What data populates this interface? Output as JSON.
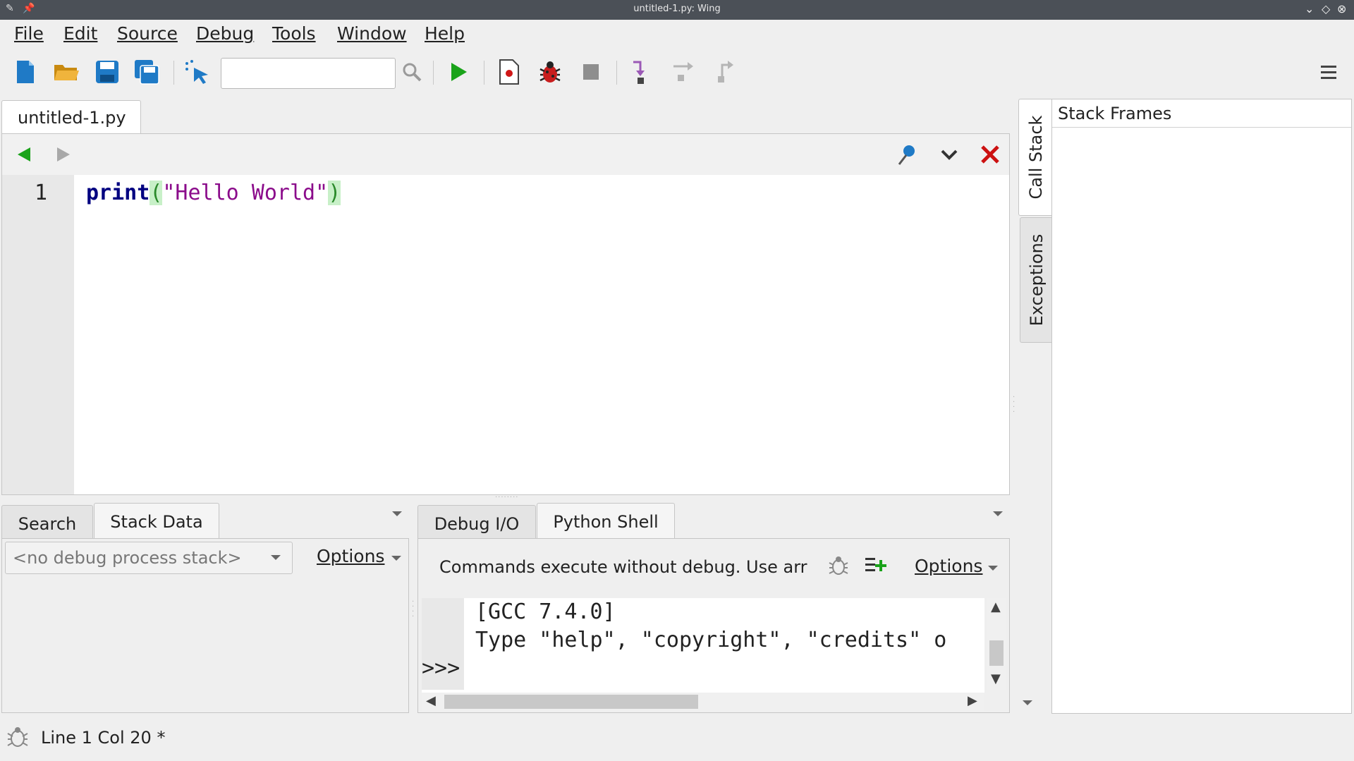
{
  "window": {
    "title": "untitled-1.py: Wing",
    "title_icons": [
      "pencil-icon",
      "pin-icon"
    ],
    "controls": [
      "minimize-icon",
      "restore-icon",
      "close-icon"
    ]
  },
  "menu": [
    {
      "label": "File"
    },
    {
      "label": "Edit"
    },
    {
      "label": "Source"
    },
    {
      "label": "Debug"
    },
    {
      "label": "Tools"
    },
    {
      "label": "Window"
    },
    {
      "label": "Help"
    }
  ],
  "toolbar": {
    "search_value": "",
    "icons": [
      "new-file-icon",
      "open-folder-icon",
      "save-icon",
      "save-all-icon",
      "select-pointer-icon",
      "search-icon",
      "run-icon",
      "breakpoint-icon",
      "debug-bug-icon",
      "stop-icon",
      "step-into-icon",
      "step-over-icon",
      "step-out-icon",
      "hamburger-menu-icon"
    ]
  },
  "editor": {
    "tab_label": "untitled-1.py",
    "line_numbers": [
      "1"
    ],
    "code": {
      "keyword": "print",
      "open_paren": "(",
      "string": "\"Hello World\"",
      "close_paren": ")"
    }
  },
  "left_panel": {
    "tabs": [
      {
        "label": "Search"
      },
      {
        "label": "Stack Data"
      }
    ],
    "active_tab": "Stack Data",
    "stack_combo_value": "<no debug process stack>",
    "options_label": "Options"
  },
  "shell_panel": {
    "tabs": [
      {
        "label": "Debug I/O"
      },
      {
        "label": "Python Shell"
      }
    ],
    "active_tab": "Python Shell",
    "message": "Commands execute without debug.  Use arr",
    "options_label": "Options",
    "output_lines": [
      "[GCC 7.4.0]",
      "Type \"help\", \"copyright\", \"credits\" o"
    ],
    "prompt": ">>>"
  },
  "right_panel": {
    "vertical_tabs": [
      {
        "label": "Call Stack"
      },
      {
        "label": "Exceptions"
      }
    ],
    "active_tab": "Call Stack",
    "header": "Stack Frames"
  },
  "status": {
    "text": "Line 1 Col 20 *"
  },
  "colors": {
    "titlebar": "#4b5057",
    "keyword": "#000080",
    "string": "#8b0c8b",
    "paren_bg": "#c8f0c8",
    "run_green": "#1aa31a",
    "close_red": "#cc1111",
    "save_blue": "#1f7ac6"
  }
}
